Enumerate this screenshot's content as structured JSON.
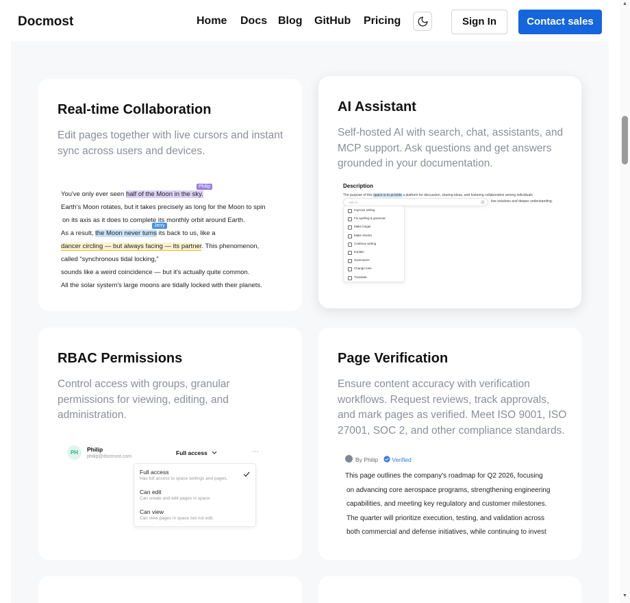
{
  "header": {
    "logo": "Docmost",
    "nav": [
      "Home",
      "Docs",
      "Blog",
      "GitHub",
      "Pricing"
    ],
    "theme_icon": "moon-icon",
    "sign_in": "Sign In",
    "contact_sales": "Contact sales"
  },
  "cards": {
    "collab": {
      "title": "Real-time Collaboration",
      "desc": "Edit pages together with live cursors and instant sync across users and devices.",
      "preview": {
        "l1_pre": "You've only ever seen ",
        "l1_hl": "half of the Moon in the sky.",
        "tag_philip": "Philip",
        "l2": "Earth's Moon rotates, but it takes precisely as long for the Moon to spin",
        "l3": "on its axis as it does to complete its monthly orbit around Earth.",
        "tag_jerry": "Jerry",
        "l4_pre": "As a result, ",
        "l4_hl": "the Moon never turns",
        "l4_post": " its back to us, like a",
        "l5_hl": "dancer circling — but always facing — its partner",
        "l5_post": ". This phenomenon,",
        "l6": "called “synchronous tidal locking,”",
        "l7": "sounds like a weird coincidence — but it's actually quite common.",
        "l8": "All the solar system's large moons are tidally locked with their planets.",
        "colors": {
          "philip": "#9b7ee0",
          "jerry": "#4a90e2"
        }
      }
    },
    "ai": {
      "title": "AI Assistant",
      "desc": "Self-hosted AI with search, chat, assistants, and MCP support. Ask questions and get answers grounded in your documentation.",
      "preview": {
        "heading": "Description",
        "line_pre": "The purpose of this ",
        "line_hl": "space is to provide",
        "line_post": " a platform for discussion, sharing ideas, and fostering collaboration among individuals",
        "line2": "tive solutions and deeper understanding.",
        "input_placeholder": "Ask AI...",
        "menu": [
          "Improve writing",
          "Fix spelling & grammar",
          "Make longer",
          "Make shorter",
          "Continue writing",
          "Explain",
          "Summarize",
          "Change tone",
          "Translate"
        ]
      }
    },
    "rbac": {
      "title": "RBAC Permissions",
      "desc": "Control access with groups, granular permissions for viewing, editing, and administration.",
      "preview": {
        "avatar": "PH",
        "name": "Philip",
        "email": "philip@docmost.com",
        "role": "Full access",
        "options": [
          {
            "title": "Full access",
            "sub": "Has full access to space settings and pages."
          },
          {
            "title": "Can edit",
            "sub": "Can create and edit pages in space."
          },
          {
            "title": "Can view",
            "sub": "Can view pages in space but not edit."
          }
        ]
      }
    },
    "verify": {
      "title": "Page Verification",
      "desc": "Ensure content accuracy with verification workflows. Request reviews, track approvals, and mark pages as verified. Meet ISO 9001, ISO 27001, SOC 2, and other compliance standards.",
      "preview": {
        "by": "By Philip",
        "badge": "Verified",
        "lines": [
          "This page outlines the company's roadmap for Q2 2026, focusing",
          "on advancing core aerospace programs, strengthening engineering",
          "capabilities, and meeting key regulatory and customer milestones.",
          "The quarter will prioritize execution, testing, and validation across",
          "both commercial and defense initiatives, while continuing to invest"
        ]
      }
    }
  },
  "colors": {
    "accent": "#1565dc",
    "verified": "#2f7ae5",
    "bg": "#f7f8fa"
  }
}
